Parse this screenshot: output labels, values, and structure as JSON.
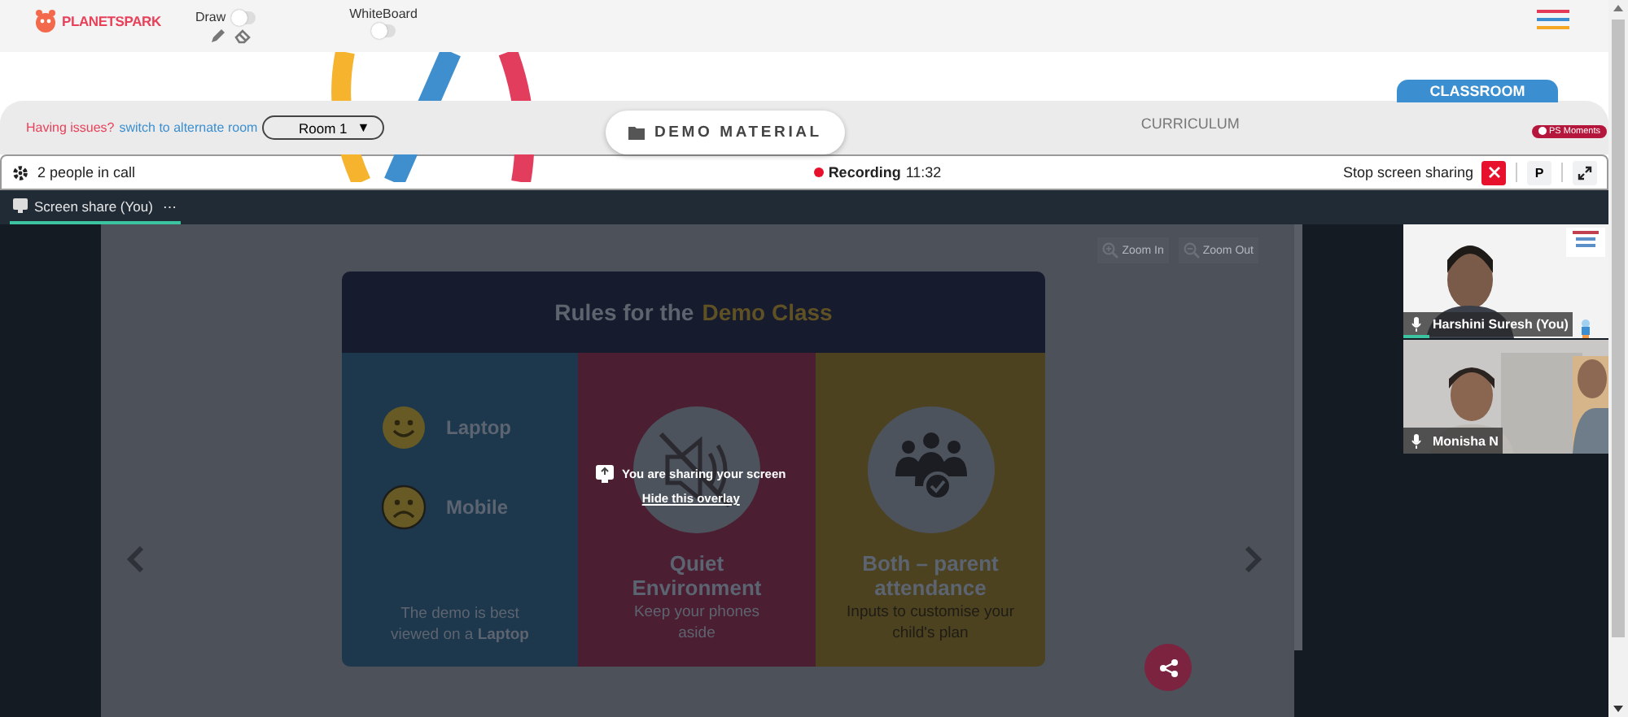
{
  "top_bar": {
    "logo": "PLANETSPARK",
    "draw_toggle": {
      "label": "Draw",
      "on": false
    },
    "whiteboard_toggle": {
      "label": "WhiteBoard",
      "on": false
    }
  },
  "room_bar": {
    "issue_text": "Having issues?",
    "switch_link": "switch to alternate room",
    "room_select": "Room 1",
    "room_caret": "▼",
    "tabs": [
      {
        "label": "DEMO MATERIAL",
        "selected": true
      },
      {
        "label": "CURRICULUM",
        "selected": false
      }
    ],
    "classroom_tab": {
      "label": "CLASSROOM"
    },
    "moments_badge": "PS Moments"
  },
  "call_bar": {
    "people_count": "2 people in call",
    "recording": {
      "label": "Recording",
      "time": "11:32"
    },
    "stop_label": "Stop screen sharing",
    "pin_button": "P"
  },
  "stage_tab": {
    "label": "Screen share (You)",
    "more": "⋯",
    "selected": true
  },
  "zoom_buttons": [
    "Zoom In",
    "Zoom Out"
  ],
  "slide": {
    "title_start": "Rules for the",
    "title_highlight": "Demo Class",
    "columns": [
      {
        "kind": "devices",
        "items": [
          {
            "kind": "happy",
            "label": "Laptop"
          },
          {
            "kind": "sad",
            "label": "Mobile"
          }
        ],
        "caption": "The demo is best viewed on a **Laptop**"
      },
      {
        "kind": "quiet",
        "heading": "Quiet Environment",
        "caption": "Keep your phones aside"
      },
      {
        "kind": "parents",
        "heading": "Both – parent attendance",
        "caption": "Inputs to customise your child's plan"
      }
    ]
  },
  "overlay": {
    "message": "You are sharing your screen",
    "hide_link": "Hide this overlay"
  },
  "videos": [
    {
      "name": "Harshini Suresh (You)",
      "speaking": true
    },
    {
      "name": "Monisha N",
      "speaking": false
    }
  ]
}
